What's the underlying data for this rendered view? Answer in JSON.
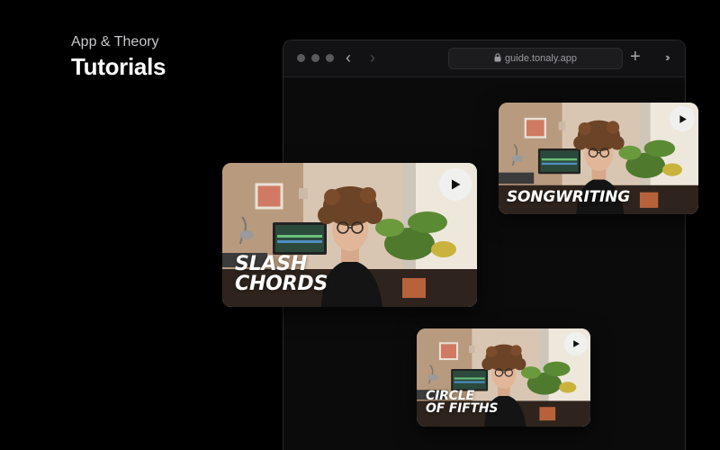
{
  "header": {
    "kicker": "App & Theory",
    "title": "Tutorials"
  },
  "browser": {
    "url": "guide.tonaly.app",
    "window_controls": [
      "close-dot",
      "minimize-dot",
      "zoom-dot"
    ],
    "icons": [
      "chevron-left-icon",
      "chevron-right-icon",
      "lock-icon",
      "plus-icon",
      "double-chevron-right-icon"
    ]
  },
  "videos": [
    {
      "title": "SLASH\nCHORDS",
      "icon": "play-icon"
    },
    {
      "title": "SONGWRITING",
      "icon": "play-icon"
    },
    {
      "title": "CIRCLE\nOF FIFTHS",
      "icon": "play-icon"
    }
  ],
  "colors": {
    "background": "#000000",
    "browser_bg": "#0b0b0c",
    "text_primary": "#ffffff",
    "text_secondary": "#c8c8cc"
  }
}
